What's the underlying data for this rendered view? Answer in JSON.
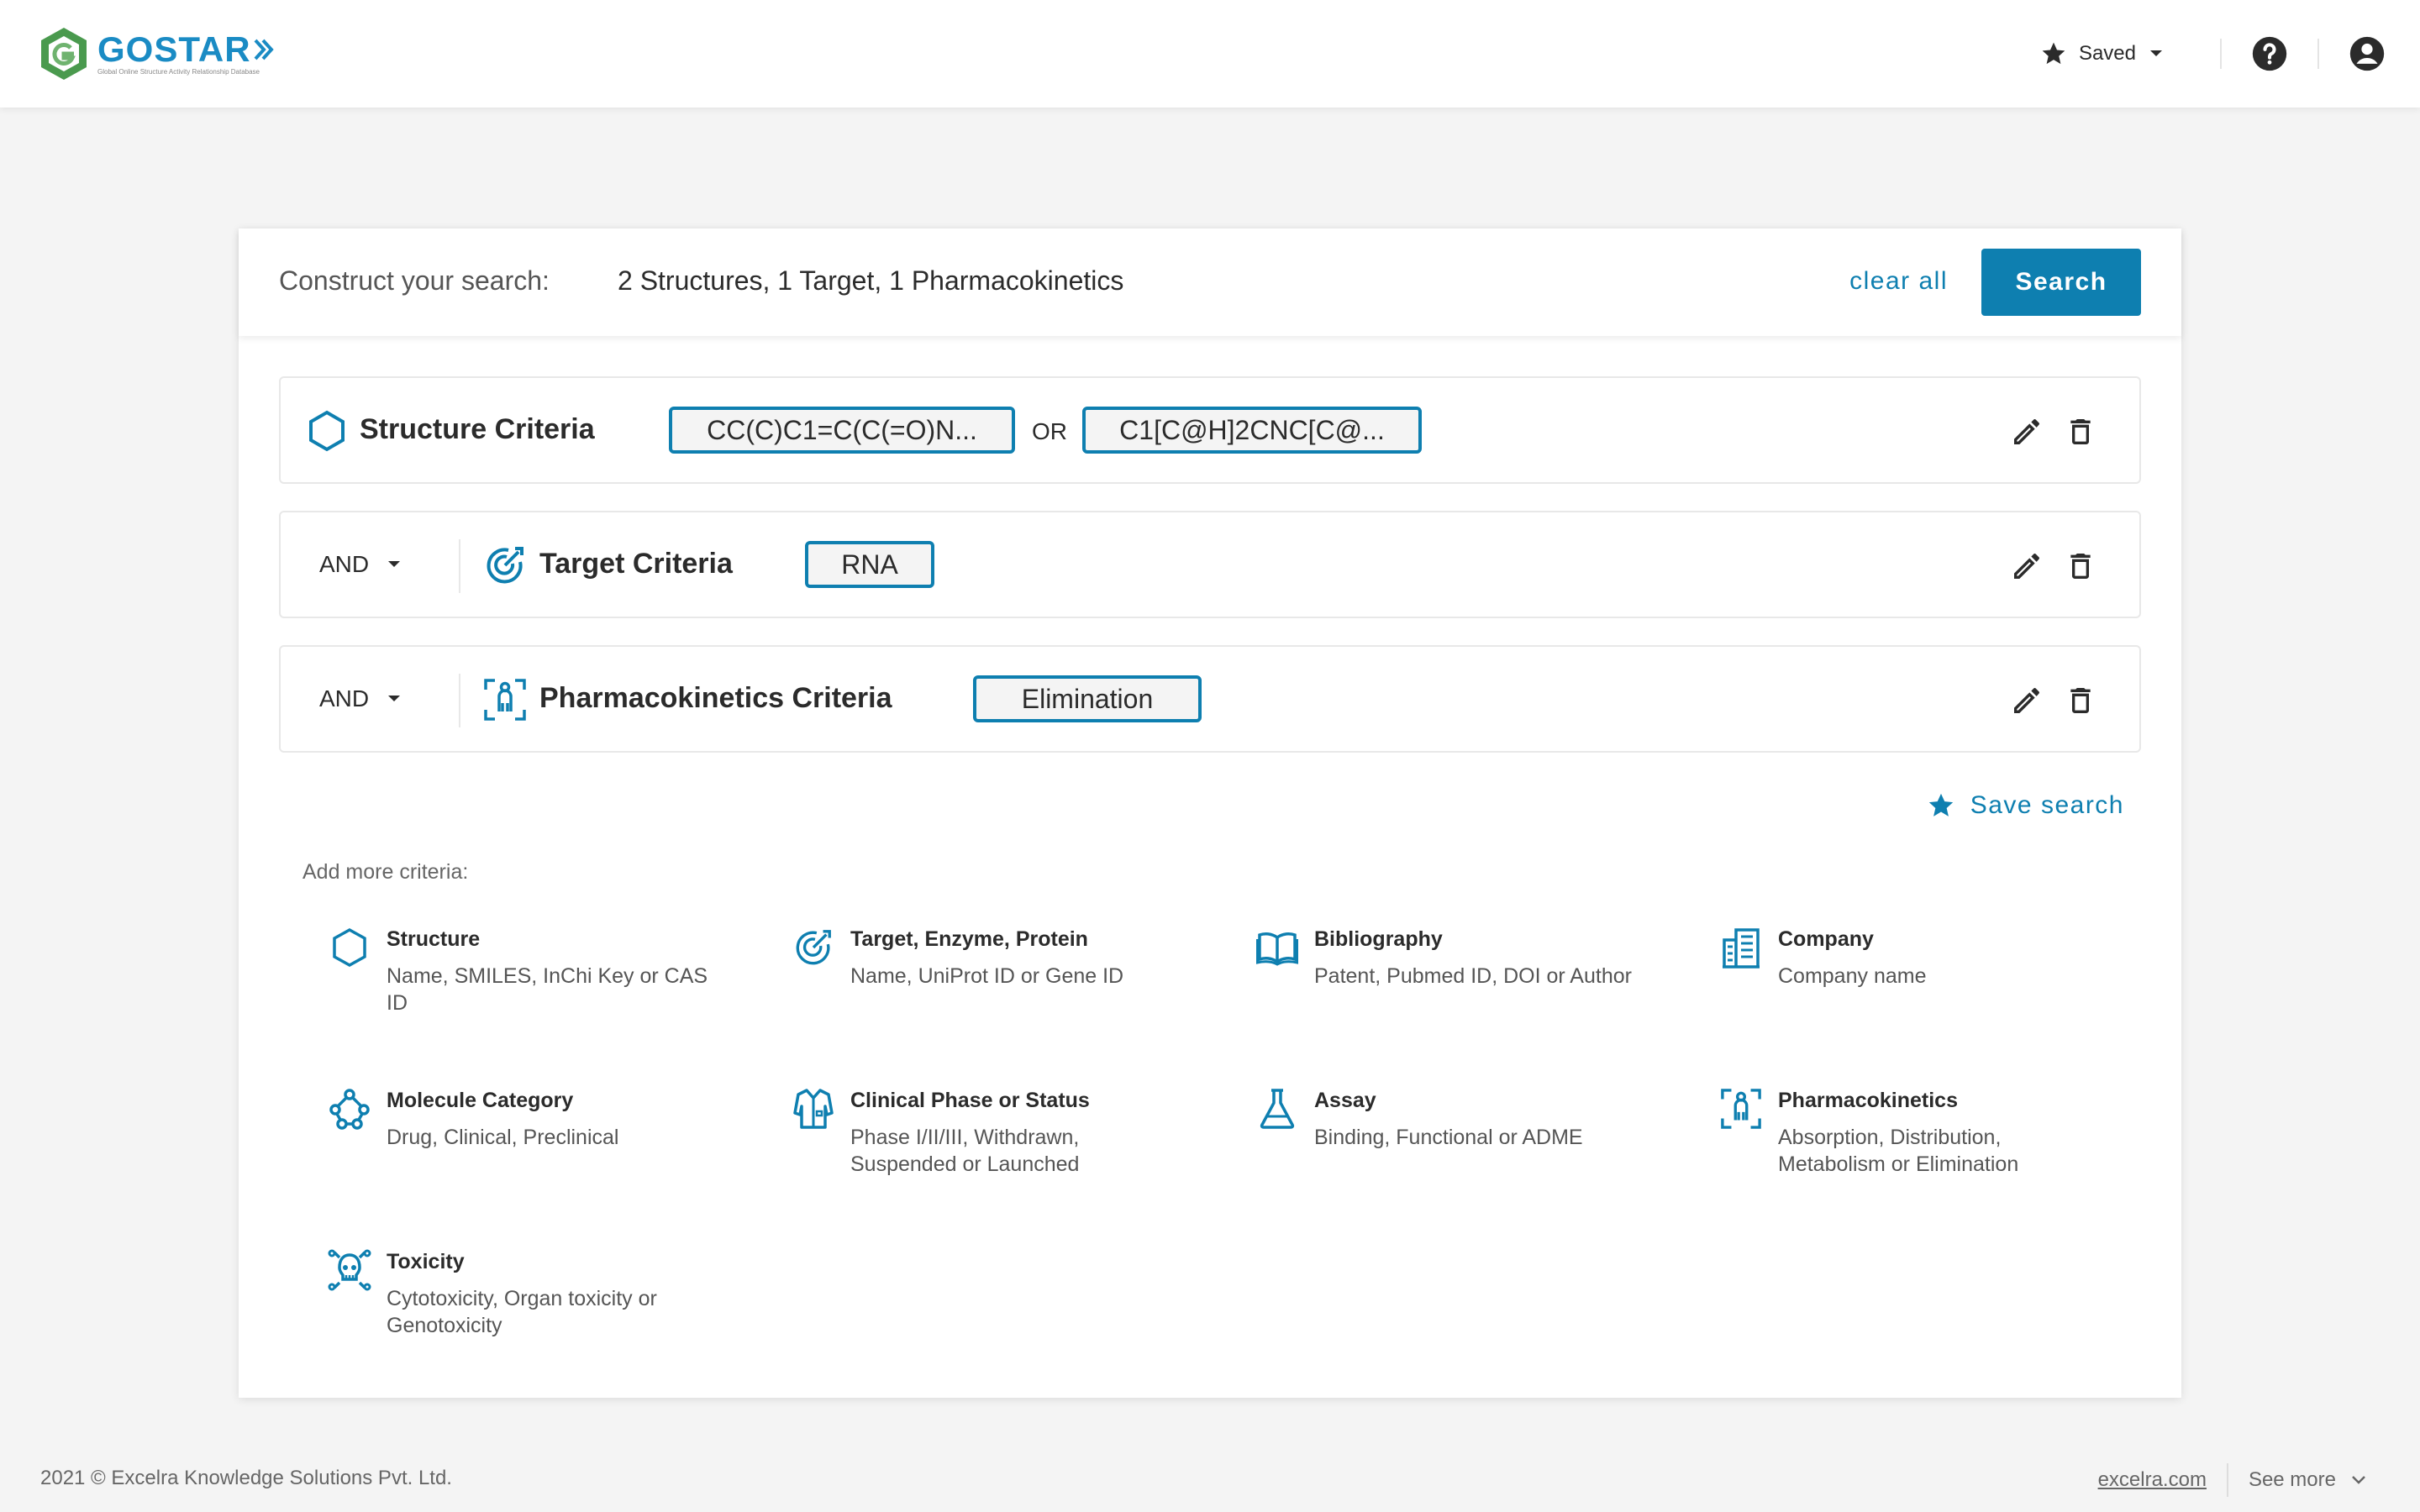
{
  "brand": {
    "name": "GOSTAR",
    "tagline": "Global Online Structure Activity Relationship Database",
    "accent": "#1a8bc4",
    "logo_green": "#4a9a4e"
  },
  "header": {
    "saved_label": "Saved",
    "icons": [
      "star-icon",
      "chevron-down-icon",
      "help-icon",
      "account-icon"
    ]
  },
  "construct": {
    "label": "Construct your search:",
    "summary": "2 Structures, 1 Target, 1 Pharmacokinetics",
    "clear_label": "clear all",
    "search_label": "Search"
  },
  "criteria": [
    {
      "title": "Structure Criteria",
      "icon": "hexagon-icon",
      "chips": [
        "CC(C)C1=C(C(=O)N...",
        "C1[C@H]2CNC[C@..."
      ],
      "joiner": "OR"
    },
    {
      "operator": "AND",
      "title": "Target Criteria",
      "icon": "target-icon",
      "chips": [
        "RNA"
      ]
    },
    {
      "operator": "AND",
      "title": "Pharmacokinetics Criteria",
      "icon": "person-scan-icon",
      "chips": [
        "Elimination"
      ]
    }
  ],
  "save_search_label": "Save search",
  "add_more": {
    "label": "Add more criteria:",
    "options": [
      {
        "title": "Structure",
        "desc": "Name, SMILES, InChi Key or CAS ID",
        "icon": "hexagon-icon"
      },
      {
        "title": "Target, Enzyme, Protein",
        "desc": "Name, UniProt ID or Gene ID",
        "icon": "target-icon"
      },
      {
        "title": "Bibliography",
        "desc": "Patent, Pubmed ID, DOI or Author",
        "icon": "book-icon"
      },
      {
        "title": "Company",
        "desc": "Company name",
        "icon": "building-icon"
      },
      {
        "title": "Molecule Category",
        "desc": "Drug, Clinical, Preclinical",
        "icon": "molecule-icon"
      },
      {
        "title": "Clinical Phase or Status",
        "desc": "Phase I/II/III, Withdrawn, Suspended or Launched",
        "icon": "lab-coat-icon"
      },
      {
        "title": "Assay",
        "desc": "Binding, Functional or ADME",
        "icon": "flask-icon"
      },
      {
        "title": "Pharmacokinetics",
        "desc": "Absorption, Distribution, Metabolism or Elimination",
        "icon": "person-scan-icon"
      },
      {
        "title": "Toxicity",
        "desc": "Cytotoxicity, Organ toxicity or Genotoxicity",
        "icon": "skull-icon"
      }
    ]
  },
  "footer": {
    "copyright": "2021 © Excelra Knowledge Solutions Pvt. Ltd.",
    "link": "excelra.com",
    "see_more": "See more"
  },
  "colors": {
    "primary": "#0e7fb0",
    "background": "#f4f4f4",
    "text": "#2b2b2b"
  }
}
